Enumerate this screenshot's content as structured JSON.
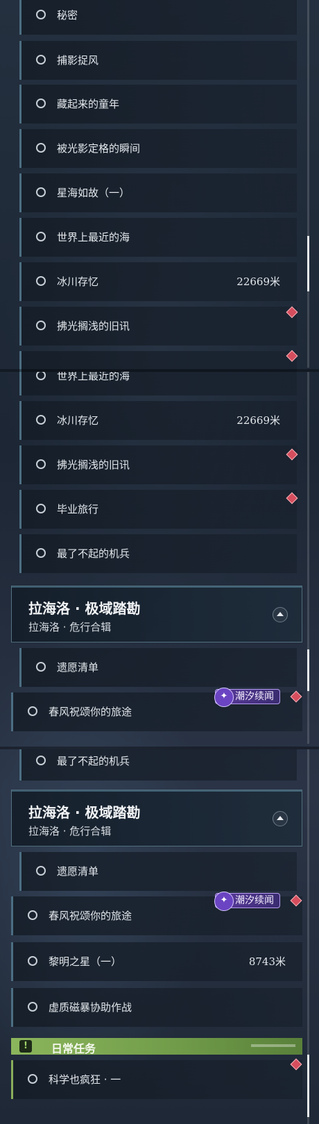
{
  "panel1": {
    "quests": [
      {
        "label": "秘密"
      },
      {
        "label": "捕影捉风"
      },
      {
        "label": "藏起来的童年"
      },
      {
        "label": "被光影定格的瞬间"
      },
      {
        "label": "星海如故（一）"
      },
      {
        "label": "世界上最近的海"
      },
      {
        "label": "冰川存忆",
        "distance": "22669米"
      },
      {
        "label": "拂光搁浅的旧讯"
      }
    ]
  },
  "panel2": {
    "quests": [
      {
        "label": "世界上最近的海"
      },
      {
        "label": "冰川存忆",
        "distance": "22669米"
      },
      {
        "label": "拂光搁浅的旧讯"
      },
      {
        "label": "毕业旅行"
      },
      {
        "label": "最了不起的机兵"
      }
    ],
    "chapter": {
      "title": "拉海洛 · 极域踏勘",
      "subtitle": "拉海洛 · 危行合辑"
    },
    "chapter_quests": [
      {
        "label": "遗愿清单"
      },
      {
        "label": "春风祝颂你的旅途",
        "tag": "潮汐续闻"
      }
    ]
  },
  "panel3": {
    "quests": [
      {
        "label": "最了不起的机兵"
      }
    ],
    "chapter": {
      "title": "拉海洛 · 极域踏勘",
      "subtitle": "拉海洛 · 危行合辑"
    },
    "chapter_quests": [
      {
        "label": "遗愿清单"
      },
      {
        "label": "春风祝颂你的旅途",
        "tag": "潮汐续闻"
      },
      {
        "label": "黎明之星（一）",
        "distance": "8743米"
      },
      {
        "label": "虚质磁暴协助作战"
      }
    ],
    "daily": {
      "header": "日常任务",
      "icon_glyph": "!",
      "quests": [
        {
          "label": "科学也疯狂 · 一"
        }
      ]
    }
  },
  "icons": {
    "tag_icon": "swirl-icon",
    "tracked_marker": "red-diamond-icon",
    "collapse": "chevron-up-icon",
    "tag_glyph": "✦"
  },
  "colors": {
    "accent_line": "#4c6e82",
    "daily_green": "#8cb65c",
    "marker_red": "#d64e5e",
    "tag_purple": "#5b3a9e"
  }
}
